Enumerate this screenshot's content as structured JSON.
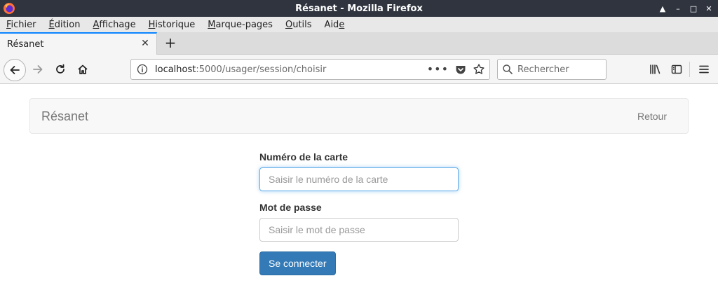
{
  "window": {
    "title": "Résanet - Mozilla Firefox",
    "controls": [
      "▲",
      "–",
      "□",
      "✕"
    ]
  },
  "menubar": {
    "items": [
      {
        "pre": "",
        "mnemonic": "F",
        "post": "ichier"
      },
      {
        "pre": "",
        "mnemonic": "É",
        "post": "dition"
      },
      {
        "pre": "",
        "mnemonic": "A",
        "post": "ffichage"
      },
      {
        "pre": "",
        "mnemonic": "H",
        "post": "istorique"
      },
      {
        "pre": "",
        "mnemonic": "M",
        "post": "arque-pages"
      },
      {
        "pre": "",
        "mnemonic": "O",
        "post": "utils"
      },
      {
        "pre": "Aid",
        "mnemonic": "e",
        "post": ""
      }
    ]
  },
  "tabs": [
    {
      "title": "Résanet"
    }
  ],
  "navbar": {
    "url_host": "localhost",
    "url_path": ":5000/usager/session/choisir",
    "search_placeholder": "Rechercher"
  },
  "site": {
    "brand": "Résanet",
    "back_link": "Retour"
  },
  "form": {
    "card_label": "Numéro de la carte",
    "card_placeholder": "Saisir le numéro de la carte",
    "card_value": "",
    "password_label": "Mot de passe",
    "password_placeholder": "Saisir le mot de passe",
    "password_value": "",
    "submit_label": "Se connecter"
  },
  "colors": {
    "titlebar_bg": "#2f343f",
    "accent_tab": "#0a84ff",
    "primary_button": "#337ab7",
    "focus_border": "#66afe9"
  }
}
